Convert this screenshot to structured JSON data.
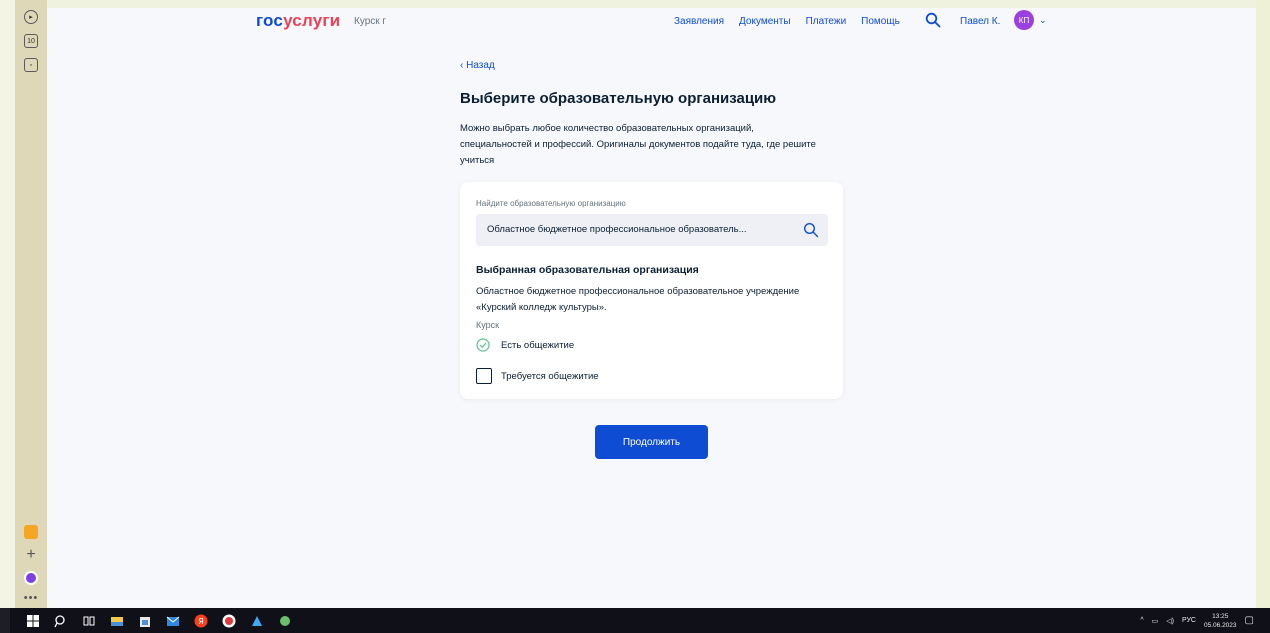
{
  "header": {
    "logo_part1": "гос",
    "logo_part2": "услуги",
    "region": "Курск г",
    "nav": [
      "Заявления",
      "Документы",
      "Платежи",
      "Помощь"
    ],
    "user_name": "Павел К.",
    "avatar_initials": "КП"
  },
  "page": {
    "back_label": "Назад",
    "title": "Выберите образовательную организацию",
    "intro": "Можно выбрать любое количество образовательных организаций, специальностей и профессий. Оригиналы документов подайте туда, где решите учиться"
  },
  "card": {
    "search_label": "Найдите образовательную организацию",
    "search_value": "Областное бюджетное профессиональное образователь...",
    "selected_heading": "Выбранная образовательная организация",
    "selected_name": "Областное бюджетное профессиональное образовательное учреждение «Курский колледж культуры».",
    "selected_city": "Курск",
    "dormitory_available": "Есть общежитие",
    "dormitory_required_label": "Требуется общежитие",
    "dormitory_required_checked": false
  },
  "actions": {
    "continue_label": "Продолжить"
  },
  "taskbar": {
    "language": "РУС",
    "time": "13:25",
    "date": "05.06.2023"
  },
  "colors": {
    "primary": "#0d4cd3",
    "logo_accent": "#ee3f58",
    "avatar": "#9b40e0",
    "success": "#5ac18e"
  }
}
